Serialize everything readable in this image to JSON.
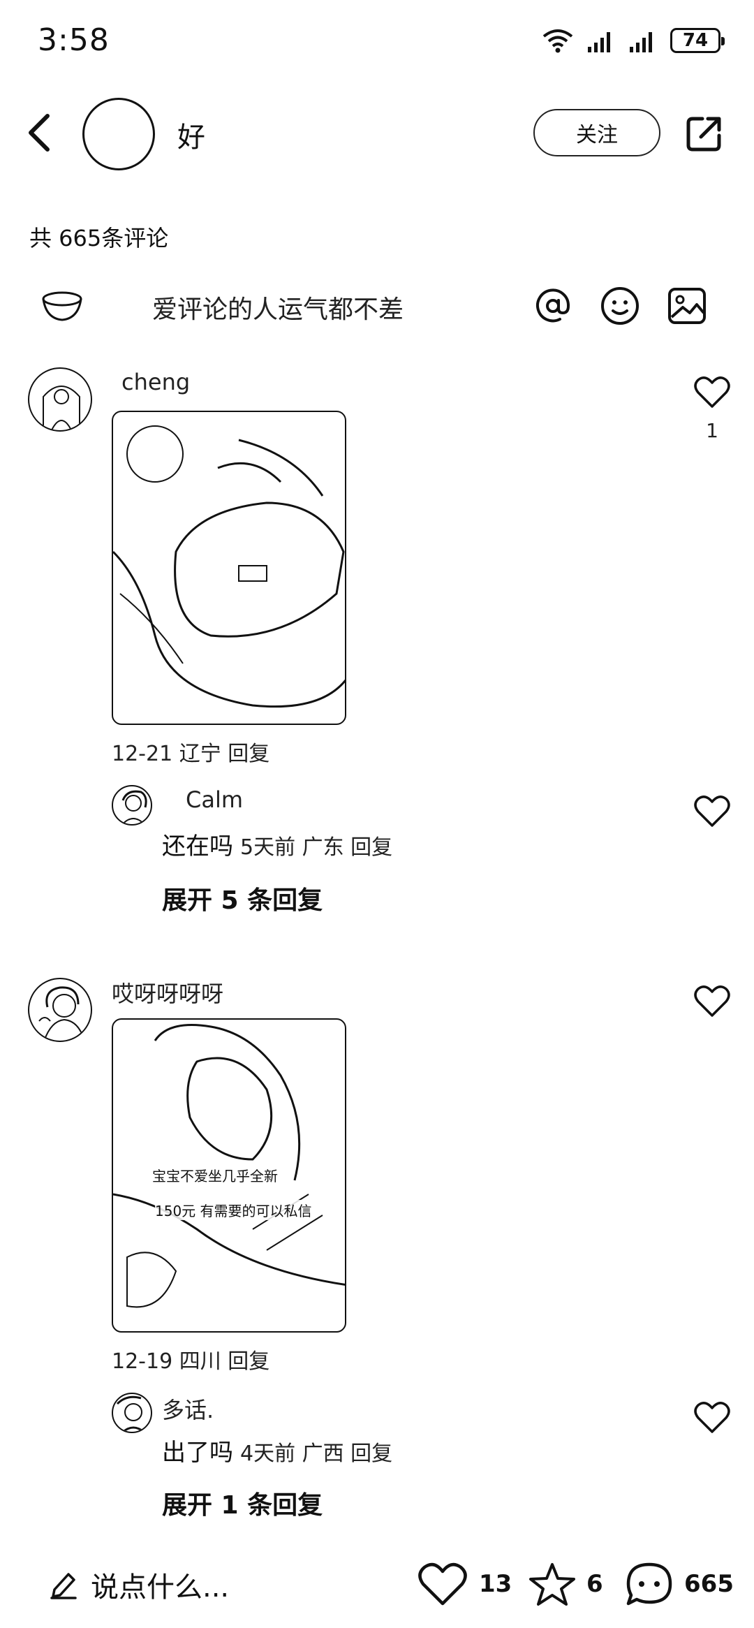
{
  "status_bar": {
    "time": "3:58",
    "battery": "74"
  },
  "header": {
    "author_name": "好",
    "follow_label": "关注"
  },
  "comments_header": {
    "total_label": "共 665条评论"
  },
  "input": {
    "placeholder": "爱评论的人运气都不差"
  },
  "comments": [
    {
      "username": "cheng",
      "meta": "12-21 辽宁 回复",
      "likes": "1",
      "reply": {
        "username": "Calm",
        "text": "还在吗",
        "meta": "5天前  广东 回复"
      },
      "expand_label": "展开 5 条回复"
    },
    {
      "username": "哎呀呀呀呀",
      "meta": "12-19 四川 回复",
      "image_caption_1": "宝宝不爱坐几乎全新",
      "image_caption_2": "150元 有需要的可以私信",
      "reply": {
        "username": "多话.",
        "text": "出了吗",
        "meta": "4天前  广西 回复"
      },
      "expand_label": "展开 1 条回复"
    }
  ],
  "bottom_bar": {
    "say_something": "说点什么...",
    "like_count": "13",
    "star_count": "6",
    "comment_count": "665"
  }
}
